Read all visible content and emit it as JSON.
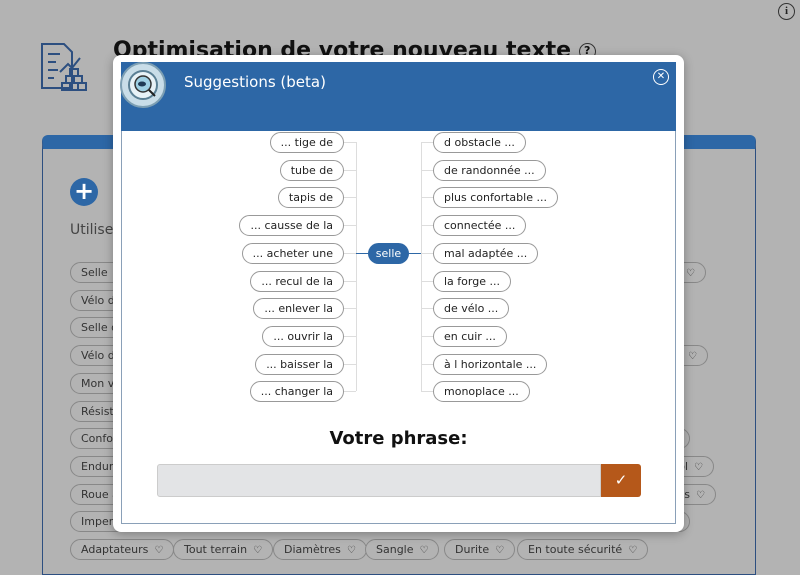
{
  "page": {
    "title": "Optimisation de votre nouveau texte",
    "help_icon": "question-circle-icon",
    "info_icon": "info-icon",
    "instruction_fragment": "Utilisez",
    "keyword_tags_left": [
      "Selle",
      "Vélo de",
      "Selle de",
      "Vélo de",
      "Mon vé",
      "Résista",
      "Confor",
      "Enduro",
      "Roue a",
      "Imperr"
    ],
    "keyword_tags_bottom": [
      "Adaptateurs",
      "Tout terrain",
      "Diamètres",
      "Sangle",
      "Durite",
      "En toute sécurité"
    ],
    "keyword_tags_right": [
      "",
      "",
      "",
      "ol",
      "us",
      ""
    ]
  },
  "modal": {
    "title": "Suggestions (beta)",
    "center_word": "selle",
    "left_phrases": [
      "... tige de",
      "tube de",
      "tapis de",
      "... causse de la",
      "... acheter une",
      "... recul de la",
      "... enlever la",
      "... ouvrir la",
      "... baisser la",
      "... changer la"
    ],
    "right_phrases": [
      "d obstacle ...",
      "de randonnée ...",
      "plus confortable ...",
      "connectée ...",
      "mal adaptée ...",
      "la forge ...",
      "de vélo ...",
      "en cuir ...",
      "à l horizontale ...",
      "monoplace ..."
    ],
    "phrase_label": "Votre phrase:",
    "phrase_value": "",
    "colors": {
      "header": "#2d67a6",
      "confirm": "#b5581a"
    }
  }
}
